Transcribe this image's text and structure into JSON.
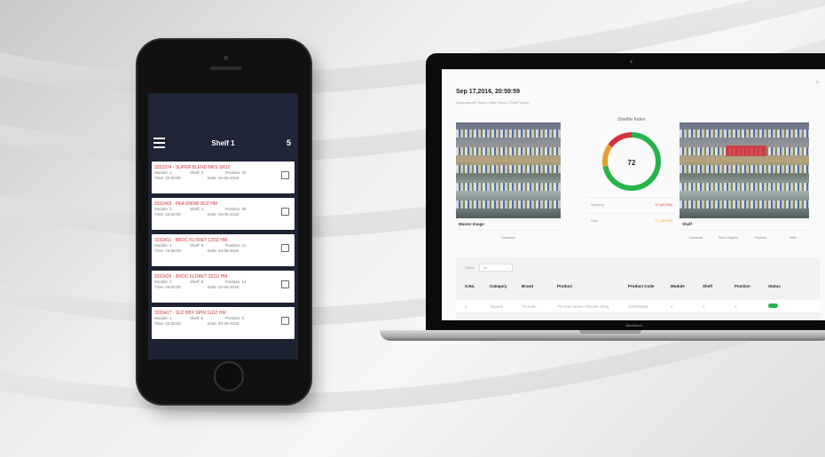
{
  "phone": {
    "header_title": "Shelf 1",
    "header_count": "5",
    "items": [
      {
        "name": "3333374 - SUPER BLEND MKS 10OZ",
        "module": "Module: 1",
        "shelf": "Shelf: 2",
        "position": "Position: 32",
        "time": "Time: 23:00:00",
        "date": "Date: 03-06-2018"
      },
      {
        "name": "3333403 - PEA SNOW 8OZ HM",
        "module": "Module: 1",
        "shelf": "Shelf: 4",
        "position": "Position: 29",
        "time": "Time: 23:00:00",
        "date": "Date: 03-06-2018"
      },
      {
        "name": "3333411 - BROC FLORET 12OZ HM",
        "module": "Module: 1",
        "shelf": "Shelf: 5",
        "position": "Position: 11",
        "time": "Time: 23:00:00",
        "date": "Date: 03-06-2018"
      },
      {
        "name": "3333426 - BROC FLORET 32OZ HM",
        "module": "Module: 1",
        "shelf": "Shelf: 6",
        "position": "Position: 14",
        "time": "Time: 23:00:00",
        "date": "Date: 03-06-2018"
      },
      {
        "name": "3333417 - SLD BBY SPIN 11OZ HM",
        "module": "Module: 1",
        "shelf": "Shelf: 6",
        "position": "Position: 5",
        "time": "Time: 23:00:00",
        "date": "Date: 03-06-2018"
      }
    ]
  },
  "dashboard": {
    "date": "Sep 17,2016, 20:59:59",
    "breadcrumb": "Supermarket Tesco / Aisle Tesco / Shelf Yogurt",
    "close": "×",
    "master_label": "Master Image",
    "master_button": "Download",
    "shelf_label": "Shelf",
    "shelf_buttons": [
      "Download",
      "Show Original",
      "Previous",
      "Next"
    ],
    "gauge_title": "Shelfie Index",
    "gauge_value": "72",
    "gauge_segments": [
      {
        "name": "ok",
        "fraction": 0.72,
        "color": "#27b44a"
      },
      {
        "name": "warning",
        "fraction": 0.13,
        "color": "#e3a02b"
      },
      {
        "name": "gap",
        "fraction": 0.15,
        "color": "#d4323c"
      }
    ],
    "stats": [
      {
        "label": "Warning",
        "value": "17 (40.5%)",
        "color": "red"
      },
      {
        "label": "Gap",
        "value": "17 (40.5%)",
        "color": "orange"
      }
    ],
    "filter_label": "Status",
    "filter_value": "All",
    "table_headers": [
      "S.No.",
      "Category",
      "Brand",
      "Product",
      "Product Code",
      "Module",
      "Shelf",
      "Position",
      "Status"
    ],
    "table_row": [
      "1",
      "Yogurts",
      "TS Activ",
      "TS Activ Mixes Yahoole 650g",
      "223311542",
      "4",
      "1",
      "1",
      "OK"
    ],
    "status_color": "#27b44a"
  },
  "laptop_brand": "MacBook"
}
